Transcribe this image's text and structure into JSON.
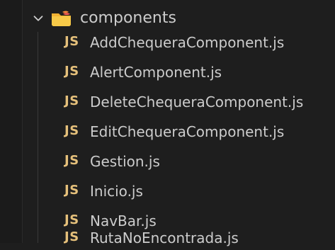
{
  "explorer": {
    "folder": {
      "label": "components",
      "expanded": true,
      "chevron_icon": "chevron-down-icon",
      "folder_icon": "folder-icon",
      "folder_color": "#f2b233"
    },
    "files": [
      {
        "icon_text": "JS",
        "label": "AddChequeraComponent.js"
      },
      {
        "icon_text": "JS",
        "label": "AlertComponent.js"
      },
      {
        "icon_text": "JS",
        "label": "DeleteChequeraComponent.js"
      },
      {
        "icon_text": "JS",
        "label": "EditChequeraComponent.js"
      },
      {
        "icon_text": "JS",
        "label": "Gestion.js"
      },
      {
        "icon_text": "JS",
        "label": "Inicio.js"
      },
      {
        "icon_text": "JS",
        "label": "NavBar.js"
      },
      {
        "icon_text": "JS",
        "label": "RutaNoEncontrada.js"
      }
    ],
    "file_icon_color": "#e5c07b"
  }
}
